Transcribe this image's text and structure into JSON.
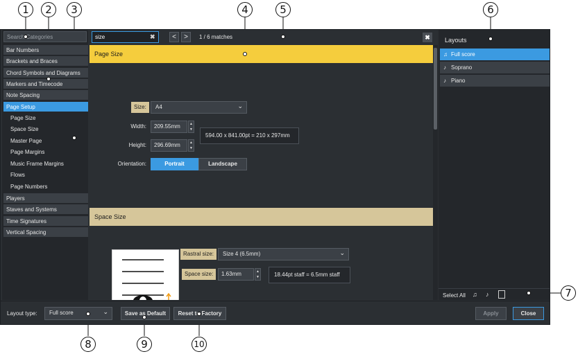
{
  "search": {
    "placeholder": "Search Categories"
  },
  "categories": [
    {
      "label": "Bar Numbers"
    },
    {
      "label": "Brackets and Braces"
    },
    {
      "label": "Chord Symbols and Diagrams"
    },
    {
      "label": "Markers and Timecode"
    },
    {
      "label": "Note Spacing"
    },
    {
      "label": "Page Setup"
    },
    {
      "label": "Players"
    },
    {
      "label": "Staves and Systems"
    },
    {
      "label": "Time Signatures"
    },
    {
      "label": "Vertical Spacing"
    }
  ],
  "subcategories": [
    "Page Size",
    "Space Size",
    "Master Page",
    "Page Margins",
    "Music Frame Margins",
    "Flows",
    "Page Numbers"
  ],
  "find": {
    "value": "size",
    "matches": "1 / 6 matches",
    "prev": "<",
    "next": ">",
    "clear": "✖",
    "close": "✖"
  },
  "page_size": {
    "header": "Page Size",
    "size_label": "Size:",
    "size_value": "A4",
    "width_label": "Width:",
    "width_value": "209.55mm",
    "height_label": "Height:",
    "height_value": "296.69mm",
    "dims_info": "594.00 x 841.00pt = 210 x 297mm",
    "orientation_label": "Orientation:",
    "portrait": "Portrait",
    "landscape": "Landscape"
  },
  "space_size": {
    "header": "Space Size",
    "rastral_label": "Rastral size:",
    "rastral_value": "Size 4 (6.5mm)",
    "space_label": "Space size:",
    "space_value": "1.63mm",
    "staff_info": "18.44pt staff = 6.5mm staff"
  },
  "layouts": {
    "title": "Layouts",
    "items": [
      {
        "label": "Full score",
        "icon": "full-score-icon"
      },
      {
        "label": "Soprano",
        "icon": "part-icon"
      },
      {
        "label": "Piano",
        "icon": "part-icon"
      }
    ],
    "select_all": "Select All"
  },
  "bottom": {
    "layout_type_label": "Layout type:",
    "layout_type_value": "Full score",
    "save_default": "Save as Default",
    "reset_factory": "Reset to Factory",
    "apply": "Apply",
    "close": "Close"
  },
  "callouts": [
    "1",
    "2",
    "3",
    "4",
    "5",
    "6",
    "7",
    "8",
    "9",
    "10"
  ],
  "colors": {
    "accent": "#3b9ae1",
    "section_active": "#f5cd3d",
    "section_inactive": "#d6c69a"
  }
}
